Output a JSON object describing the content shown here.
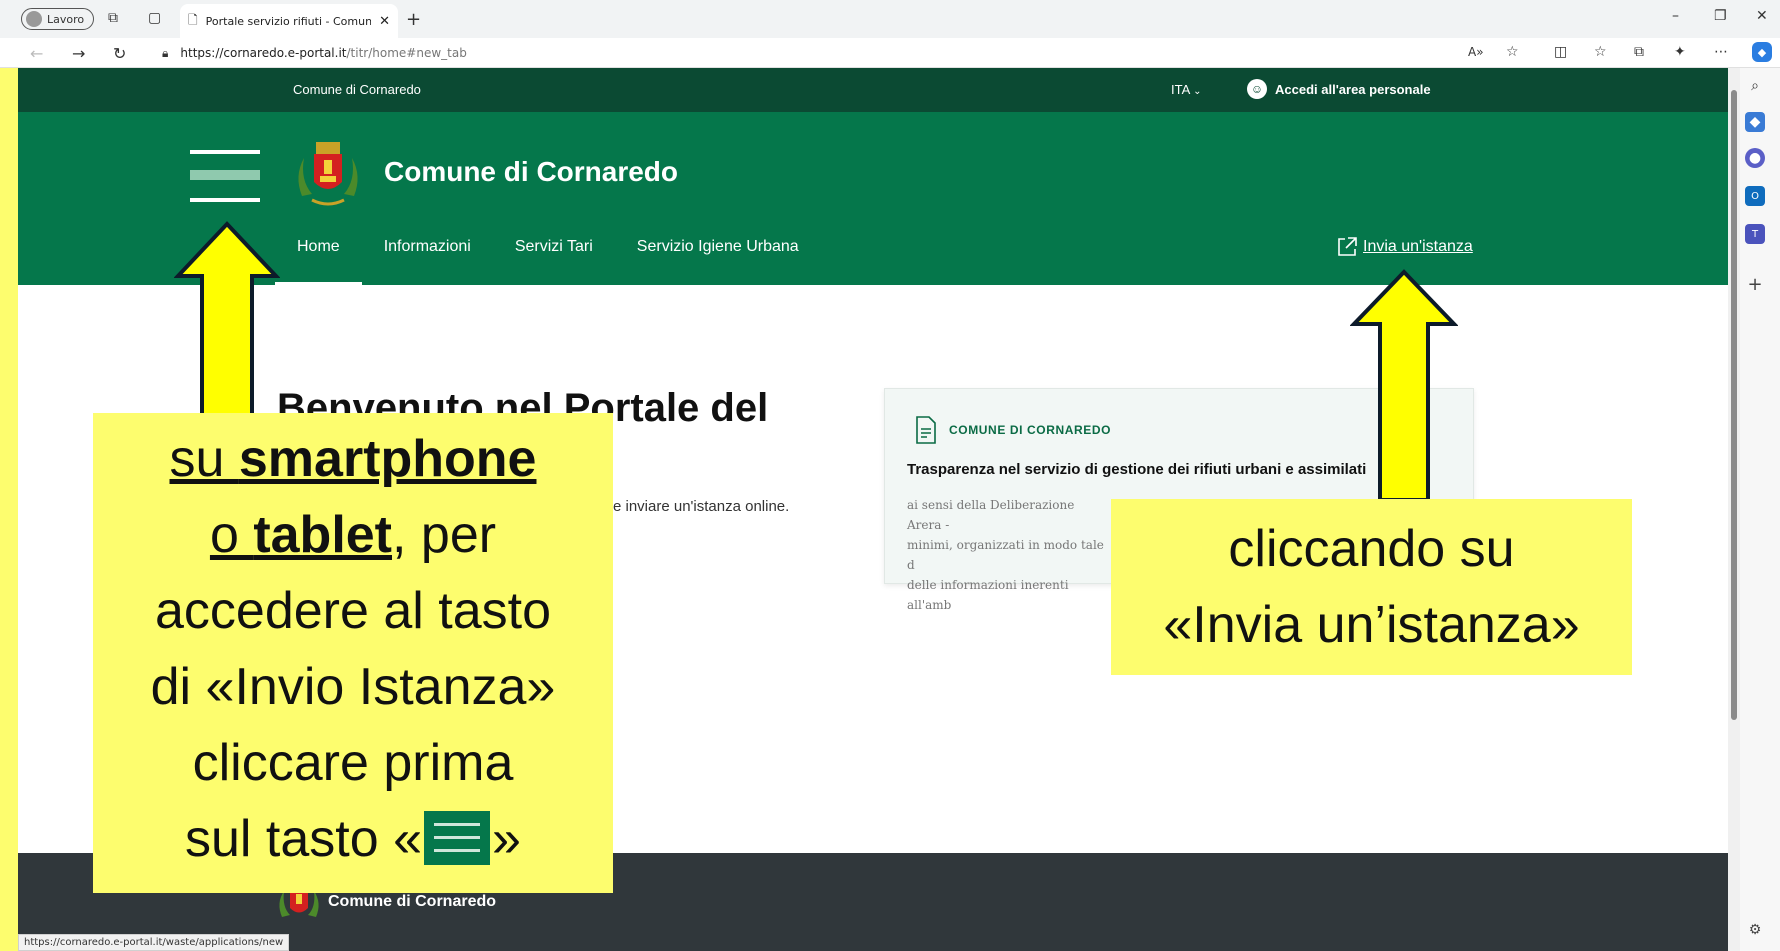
{
  "browser": {
    "profile_label": "Lavoro",
    "tab_title": "Portale servizio rifiuti - Comune di Cornaredo",
    "url_host": "https://cornaredo.e-portal.it",
    "url_path": "/titr/home#new_tab",
    "status_url": "https://cornaredo.e-portal.it/waste/applications/new"
  },
  "site": {
    "topbar_org": "Comune di Cornaredo",
    "language": "ITA",
    "login_label": "Accedi all'area personale",
    "title": "Comune di Cornaredo",
    "nav": [
      "Home",
      "Informazioni",
      "Servizi Tari",
      "Servizio Igiene Urbana"
    ],
    "invia_label": "Invia un'istanza",
    "hero_title": "Benvenuto nel Portale del",
    "hero_desc_visible": "e inviare un'istanza online.",
    "card": {
      "label": "COMUNE DI CORNAREDO",
      "title": "Trasparenza nel servizio di gestione dei rifiuti urbani e assimilati",
      "text_lines": [
        "ai sensi della Deliberazione Arera -",
        "minimi, organizzati in modo tale d",
        "delle informazioni inerenti all'amb"
      ]
    },
    "footer_title": "Comune di Cornaredo"
  },
  "annotations": {
    "left": {
      "line1_a": "su ",
      "line1_b": "smartphone",
      "line2_a": "o ",
      "line2_b": "tablet",
      "line2_c": ", per",
      "line3": "accedere al tasto",
      "line4": "di «Invio Istanza»",
      "line5": "cliccare prima",
      "line6_a": "sul tasto «",
      "line6_b": "»"
    },
    "right": {
      "line1": "cliccando su",
      "line2": "«Invia un’istanza»"
    }
  },
  "colors": {
    "header_green": "#05774b",
    "topbar_green": "#0b4a33",
    "highlight_yellow": "#fdfd6e",
    "footer_dark": "#30373b"
  }
}
